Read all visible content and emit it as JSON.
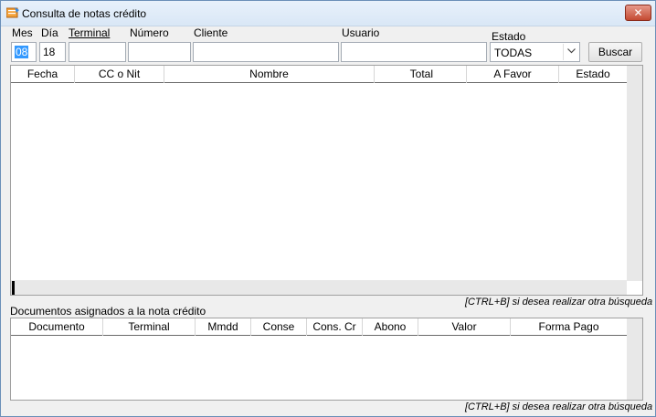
{
  "window": {
    "title": "Consulta de notas crédito",
    "close_glyph": "✕"
  },
  "filters": {
    "mes_label": "Mes",
    "dia_label": "Día",
    "terminal_label": "Terminal",
    "numero_label": "Número",
    "cliente_label": "Cliente",
    "usuario_label": "Usuario",
    "estado_label": "Estado",
    "mes_value": "08",
    "dia_value": "18",
    "terminal_value": "",
    "numero_value": "",
    "cliente_value": "",
    "usuario_value": "",
    "estado_value": "TODAS",
    "search_button": "Buscar"
  },
  "notes_grid": {
    "columns": [
      "Fecha",
      "CC o Nit",
      "Nombre",
      "Total",
      "A Favor",
      "Estado"
    ],
    "rows": []
  },
  "hint_text": "[CTRL+B] si desea realizar otra búsqueda",
  "docs_section": {
    "title": "Documentos asignados a la nota crédito",
    "columns": [
      "Documento",
      "Terminal",
      "Mmdd",
      "Conse",
      "Cons. Cr",
      "Abono",
      "Valor",
      "Forma Pago"
    ],
    "rows": []
  },
  "icons": {
    "app": "notebook-icon",
    "close": "close-icon",
    "dropdown": "chevron-down-icon"
  }
}
